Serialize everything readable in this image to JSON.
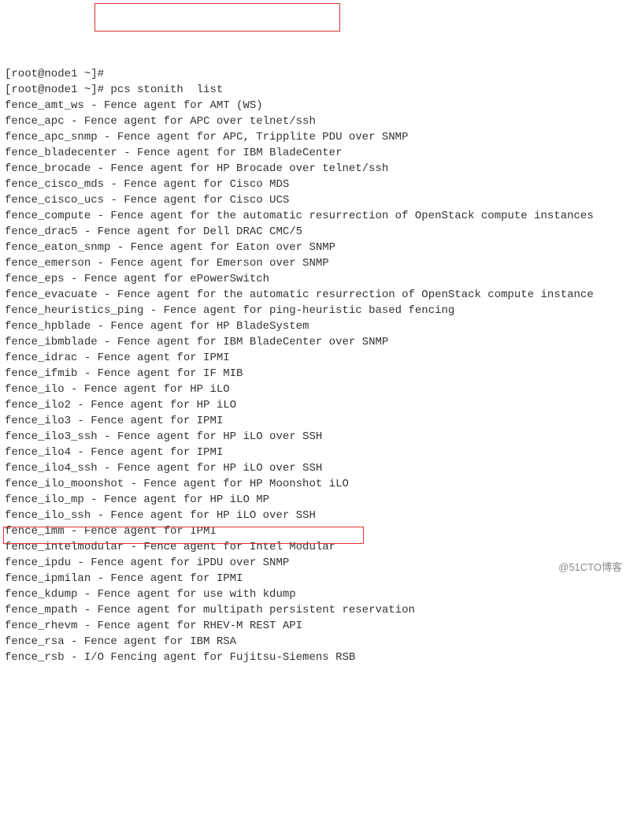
{
  "prompt_first": "[root@node1 ~]#",
  "prompt": "[root@node1 ~]# ",
  "command": "pcs stonith  list",
  "lines": [
    "fence_amt_ws - Fence agent for AMT (WS)",
    "fence_apc - Fence agent for APC over telnet/ssh",
    "fence_apc_snmp - Fence agent for APC, Tripplite PDU over SNMP",
    "fence_bladecenter - Fence agent for IBM BladeCenter",
    "fence_brocade - Fence agent for HP Brocade over telnet/ssh",
    "fence_cisco_mds - Fence agent for Cisco MDS",
    "fence_cisco_ucs - Fence agent for Cisco UCS",
    "fence_compute - Fence agent for the automatic resurrection of OpenStack compute instances",
    "fence_drac5 - Fence agent for Dell DRAC CMC/5",
    "fence_eaton_snmp - Fence agent for Eaton over SNMP",
    "fence_emerson - Fence agent for Emerson over SNMP",
    "fence_eps - Fence agent for ePowerSwitch",
    "fence_evacuate - Fence agent for the automatic resurrection of OpenStack compute instance",
    "fence_heuristics_ping - Fence agent for ping-heuristic based fencing",
    "fence_hpblade - Fence agent for HP BladeSystem",
    "fence_ibmblade - Fence agent for IBM BladeCenter over SNMP",
    "fence_idrac - Fence agent for IPMI",
    "fence_ifmib - Fence agent for IF MIB",
    "fence_ilo - Fence agent for HP iLO",
    "fence_ilo2 - Fence agent for HP iLO",
    "fence_ilo3 - Fence agent for IPMI",
    "fence_ilo3_ssh - Fence agent for HP iLO over SSH",
    "fence_ilo4 - Fence agent for IPMI",
    "fence_ilo4_ssh - Fence agent for HP iLO over SSH",
    "fence_ilo_moonshot - Fence agent for HP Moonshot iLO",
    "fence_ilo_mp - Fence agent for HP iLO MP",
    "fence_ilo_ssh - Fence agent for HP iLO over SSH",
    "fence_imm - Fence agent for IPMI",
    "fence_intelmodular - Fence agent for Intel Modular",
    "fence_ipdu - Fence agent for iPDU over SNMP",
    "fence_ipmilan - Fence agent for IPMI",
    "fence_kdump - Fence agent for use with kdump",
    "fence_mpath - Fence agent for multipath persistent reservation",
    "fence_rhevm - Fence agent for RHEV-M REST API",
    "fence_rsa - Fence agent for IBM RSA",
    "fence_rsb - I/O Fencing agent for Fujitsu-Siemens RSB"
  ],
  "watermark": "@51CTO博客"
}
